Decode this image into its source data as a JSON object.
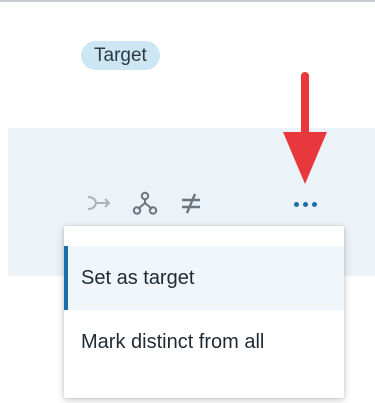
{
  "badge": {
    "label": "Target"
  },
  "toolbar": {
    "icons": [
      "merge-into-icon",
      "hierarchy-icon",
      "not-equal-icon"
    ],
    "more_icon": "more-dots-icon"
  },
  "annotation": {
    "icon": "red-down-arrow-icon",
    "color": "#e8383d"
  },
  "menu": {
    "items": [
      {
        "label": "Set as target",
        "active": true
      },
      {
        "label": "Mark distinct from all",
        "active": false
      }
    ]
  },
  "colors": {
    "accent": "#1a6fa8",
    "badge_bg": "#cce6f4",
    "band_bg": "#ecf3f8",
    "icon_gray": "#6b7680",
    "icon_light": "#aab3bb"
  }
}
